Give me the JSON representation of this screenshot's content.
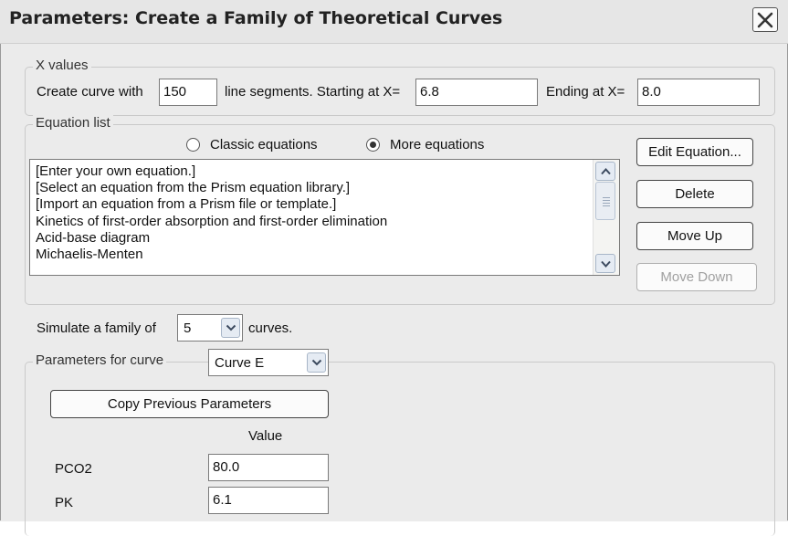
{
  "window": {
    "title": "Parameters: Create a Family of Theoretical Curves"
  },
  "x_values": {
    "legend": "X values",
    "label_create": "Create curve with",
    "segments": "150",
    "label_segments": "line segments. Starting at X=",
    "start_x": "6.8",
    "label_ending": "Ending at X=",
    "end_x": "8.0"
  },
  "equation_list": {
    "legend": "Equation list",
    "radio_classic": "Classic equations",
    "radio_more": "More equations",
    "selected_radio": "More equations",
    "items": [
      "[Enter your own equation.]",
      "[Select an equation from the Prism equation library.]",
      "[Import an equation from a Prism file or template.]",
      "Kinetics of first-order absorption and first-order elimination",
      "Acid-base diagram",
      "Michaelis-Menten"
    ],
    "buttons": {
      "edit": "Edit Equation...",
      "delete": "Delete",
      "move_up": "Move Up",
      "move_down": "Move Down"
    }
  },
  "simulate": {
    "label": "Simulate a family of",
    "count": "5",
    "suffix": "curves."
  },
  "parameters": {
    "legend": "Parameters for curve",
    "curve": "Curve E",
    "copy_button": "Copy Previous Parameters",
    "value_header": "Value",
    "rows": [
      {
        "name": "PCO2",
        "value": "80.0"
      },
      {
        "name": "PK",
        "value": "6.1"
      }
    ]
  },
  "icons": [
    "close-icon",
    "chevron-up-icon",
    "chevron-down-icon",
    "dropdown-arrow-icon"
  ]
}
